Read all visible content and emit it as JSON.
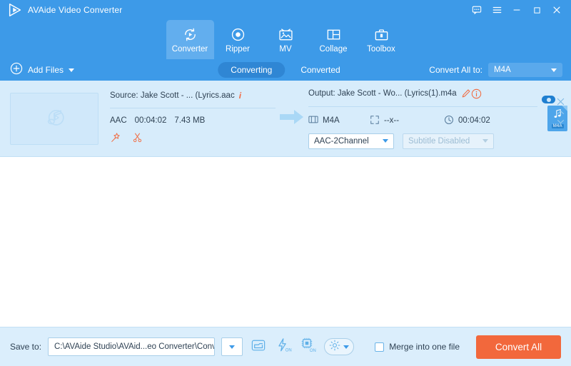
{
  "titlebar": {
    "app_title": "AVAide Video Converter",
    "logo_icon": "play-logo-icon",
    "buttons": [
      {
        "name": "feedback-button",
        "icon": "chat-bubble-icon"
      },
      {
        "name": "menu-button",
        "icon": "hamburger-menu-icon"
      },
      {
        "name": "minimize-button",
        "icon": "minimize-icon"
      },
      {
        "name": "maximize-button",
        "icon": "maximize-icon"
      },
      {
        "name": "close-button",
        "icon": "close-icon"
      }
    ]
  },
  "nav": {
    "tabs": [
      {
        "label": "Converter",
        "icon": "convert-circle-arrow-icon",
        "active": true
      },
      {
        "label": "Ripper",
        "icon": "disc-record-icon",
        "active": false
      },
      {
        "label": "MV",
        "icon": "picture-frame-icon",
        "active": false
      },
      {
        "label": "Collage",
        "icon": "grid-layout-icon",
        "active": false
      },
      {
        "label": "Toolbox",
        "icon": "toolbox-icon",
        "active": false
      }
    ]
  },
  "toolbar": {
    "add_files_label": "Add Files",
    "add_files_icon": "plus-circle-icon",
    "segments": [
      {
        "label": "Converting",
        "active": true
      },
      {
        "label": "Converted",
        "active": false
      }
    ],
    "convert_all_to_label": "Convert All to:",
    "convert_all_to_value": "M4A"
  },
  "file_row": {
    "thumbnail_icon": "music-note-play-icon",
    "source": {
      "title": "Source: Jake Scott - ... (Lyrics.aac",
      "info_icon": "info-italic-icon",
      "format": "AAC",
      "duration": "00:04:02",
      "size": "7.43 MB",
      "tools": [
        {
          "name": "edit-magic-wand-icon",
          "label": "Edit"
        },
        {
          "name": "trim-scissors-icon",
          "label": "Cut"
        }
      ]
    },
    "arrow_icon": "right-arrow-icon",
    "output": {
      "title": "Output: Jake Scott - Wo... (Lyrics(1).m4a",
      "rename_icon": "pencil-edit-icon",
      "info_icon": "info-circle-icon",
      "format_icon": "film-strip-icon",
      "format": "M4A",
      "resolution_icon": "resize-corners-icon",
      "resolution": "--x--",
      "duration_icon": "clock-icon",
      "duration": "00:04:02",
      "audio_channel": "AAC-2Channel",
      "subtitle": "Subtitle Disabled"
    },
    "output_file": {
      "ext_label": "M4A",
      "card_icon": "music-note-icon",
      "snapshot_icon": "camera-snapshot-icon",
      "dropdown_icon": "caret-down-icon"
    },
    "row_actions": [
      {
        "name": "remove-row-close-icon"
      },
      {
        "name": "move-up-chevron-icon"
      },
      {
        "name": "move-down-chevron-icon"
      }
    ]
  },
  "bottombar": {
    "save_to_label": "Save to:",
    "save_to_path": "C:\\AVAide Studio\\AVAid...eo Converter\\Converted",
    "path_dropdown_icon": "caret-down-icon",
    "icons": [
      {
        "name": "open-folder-icon",
        "state": ""
      },
      {
        "name": "hardware-acceleration-icon",
        "state": "ON"
      },
      {
        "name": "gpu-chip-icon",
        "state": "ON"
      },
      {
        "name": "settings-gear-icon",
        "state": ""
      }
    ],
    "merge_label": "Merge into one file",
    "merge_checked": false,
    "convert_all_label": "Convert All"
  },
  "colors": {
    "brand_blue": "#3d9ae8",
    "accent_orange": "#f2683c",
    "row_blue": "#d7ecfb",
    "bottom_blue": "#dbeefc"
  }
}
